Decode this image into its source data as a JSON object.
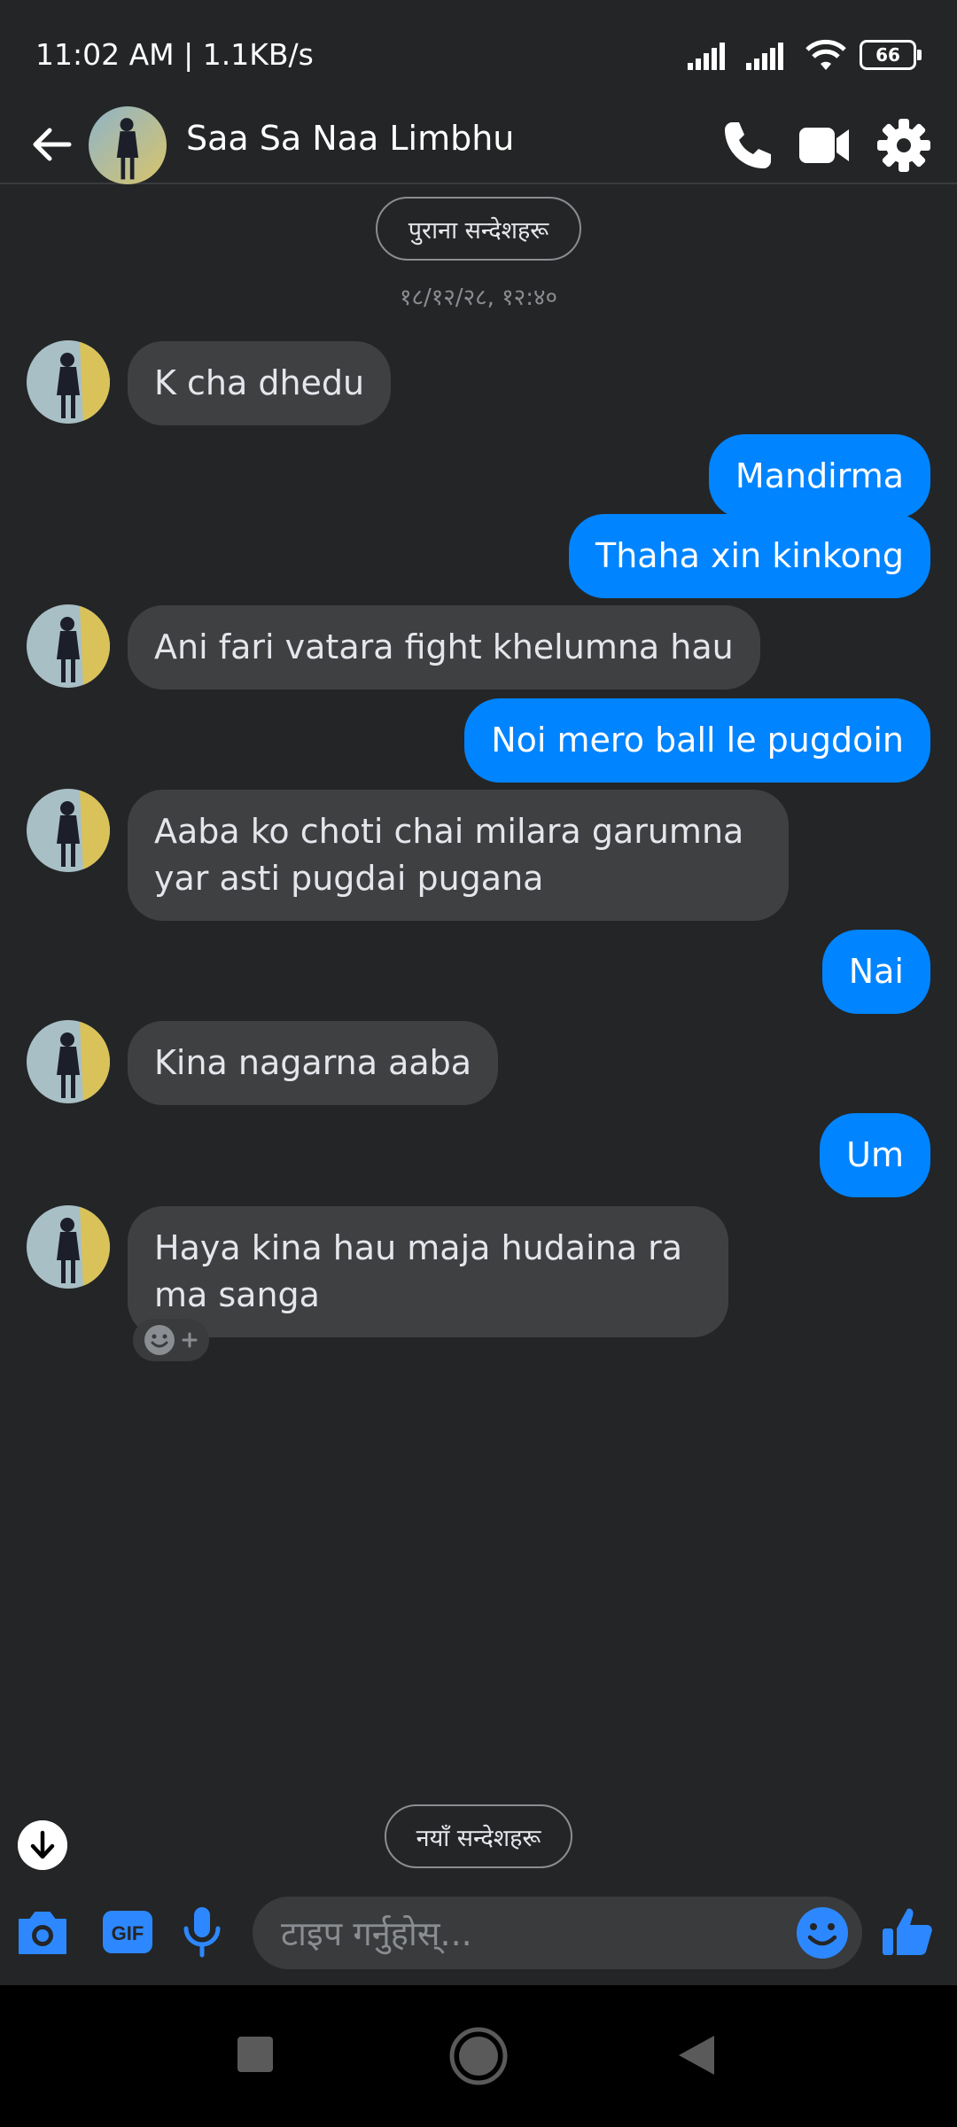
{
  "status_bar": {
    "time_speed": "11:02 AM | 1.1KB/s",
    "battery": "66"
  },
  "header": {
    "contact_name": "Saa Sa Naa Limbhu"
  },
  "older_messages_label": "पुराना सन्देशहरू",
  "timestamp": "१८/१२/२८, १२:४०",
  "messages": [
    {
      "direction": "in",
      "text": "K cha dhedu"
    },
    {
      "direction": "out",
      "text": "Mandirma"
    },
    {
      "direction": "out",
      "text": "Thaha xin kinkong"
    },
    {
      "direction": "in",
      "text": "Ani fari vatara fight khelumna hau"
    },
    {
      "direction": "out",
      "text": "Noi mero ball le pugdoin"
    },
    {
      "direction": "in",
      "text": "Aaba ko choti chai milara garumna yar asti pugdai pugana"
    },
    {
      "direction": "out",
      "text": "Nai"
    },
    {
      "direction": "in",
      "text": "Kina nagarna aaba"
    },
    {
      "direction": "out",
      "text": "Um"
    },
    {
      "direction": "in",
      "text": "Haya kina hau maja hudaina ra ma sanga"
    }
  ],
  "new_messages_label": "नयाँ सन्देशहरू",
  "composer": {
    "placeholder": "टाइप गर्नुहोस्...",
    "gif_label": "GIF"
  },
  "colors": {
    "background": "#242526",
    "outgoing_bubble": "#0084ff",
    "incoming_bubble": "#3e4042",
    "accent": "#0084ff"
  },
  "icons": [
    "back-arrow-icon",
    "phone-icon",
    "video-camera-icon",
    "settings-gear-icon",
    "camera-icon",
    "gif-icon",
    "microphone-icon",
    "emoji-icon",
    "thumbs-up-icon",
    "arrow-down-icon",
    "add-reaction-icon"
  ]
}
